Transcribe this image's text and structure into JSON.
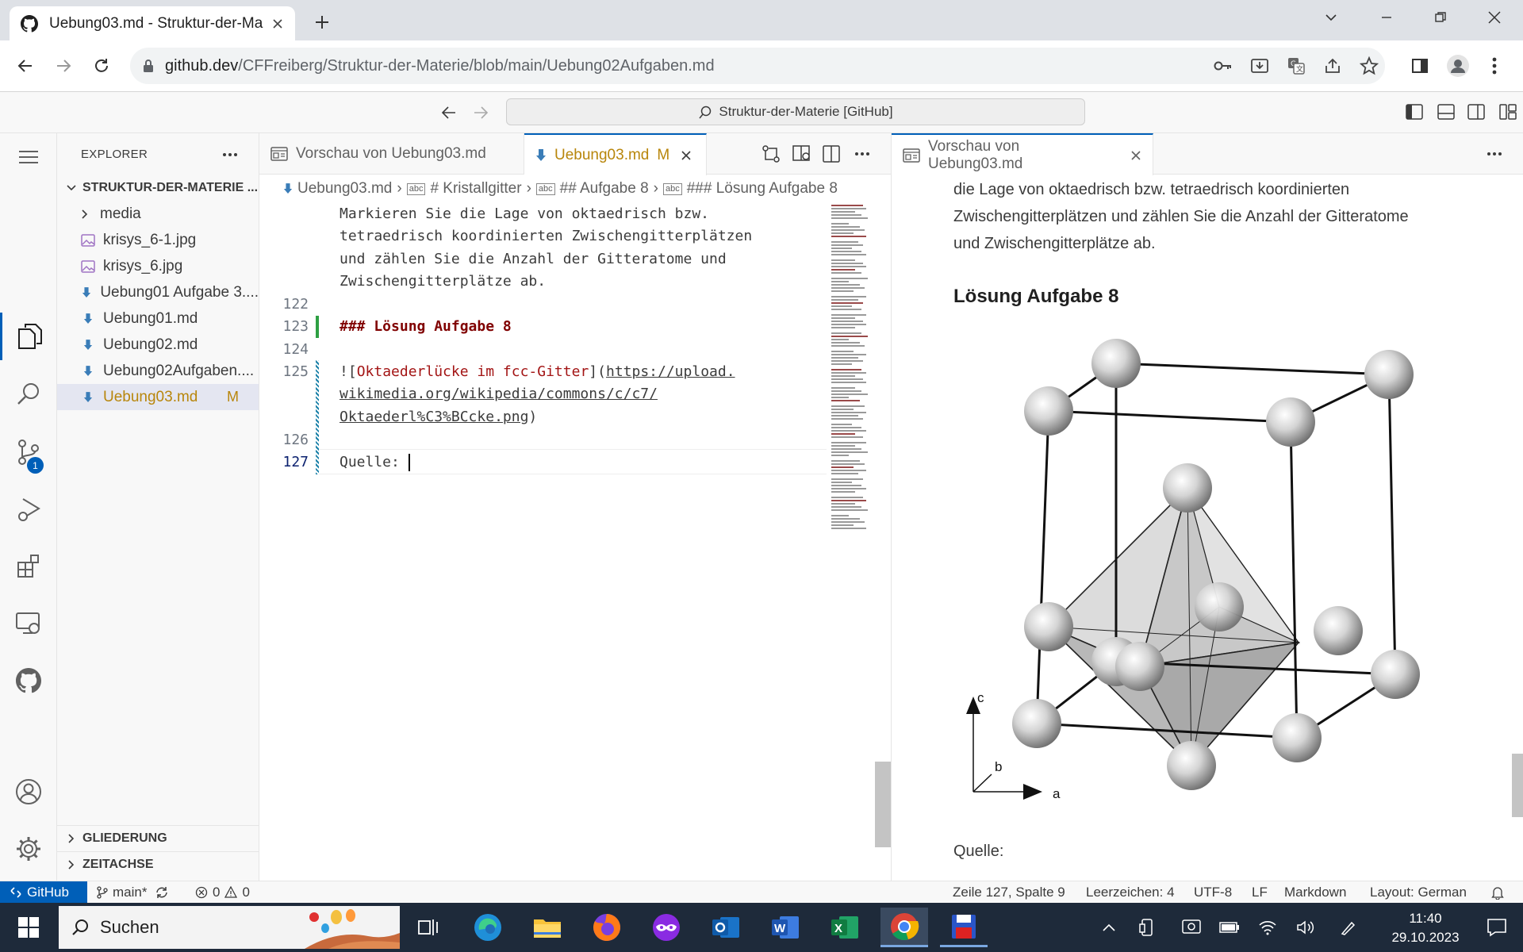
{
  "browser": {
    "tab_title": "Uebung03.md - Struktur-der-Ma",
    "url_host": "github.dev",
    "url_path": "/CFFreiberg/Struktur-der-Materie/blob/main/Uebung02Aufgaben.md"
  },
  "vscode": {
    "command_center": "Struktur-der-Materie [GitHub]"
  },
  "activity_bar": {
    "scm_badge": "1"
  },
  "sidebar": {
    "header": "EXPLORER",
    "root": "STRUKTUR-DER-MATERIE ...",
    "items": [
      {
        "label": "media",
        "kind": "folder"
      },
      {
        "label": "krisys_6-1.jpg",
        "kind": "image"
      },
      {
        "label": "krisys_6.jpg",
        "kind": "image"
      },
      {
        "label": "Uebung01 Aufgabe 3....",
        "kind": "markdown"
      },
      {
        "label": "Uebung01.md",
        "kind": "markdown"
      },
      {
        "label": "Uebung02.md",
        "kind": "markdown"
      },
      {
        "label": "Uebung02Aufgaben....",
        "kind": "markdown"
      },
      {
        "label": "Uebung03.md",
        "kind": "markdown",
        "status": "M"
      }
    ],
    "outline": "GLIEDERUNG",
    "timeline": "ZEITACHSE"
  },
  "editor1": {
    "tabs": [
      {
        "label": "Vorschau von Uebung03.md"
      },
      {
        "label": "Uebung03.md",
        "status": "M"
      }
    ],
    "breadcrumbs": [
      "Uebung03.md",
      "# Kristallgitter",
      "## Aufgabe 8",
      "### Lösung Aufgabe 8"
    ],
    "lines": [
      {
        "no": "",
        "text": "Markieren Sie die Lage von oktaedrisch bzw."
      },
      {
        "no": "",
        "text": "tetraedrisch koordinierten Zwischengitterplätzen"
      },
      {
        "no": "",
        "text": "und zählen Sie die Anzahl der Gitteratome und"
      },
      {
        "no": "",
        "text": "Zwischengitterplätze ab."
      },
      {
        "no": "122",
        "text": ""
      },
      {
        "no": "123",
        "text": "### Lösung Aufgabe 8"
      },
      {
        "no": "124",
        "text": ""
      },
      {
        "no": "125",
        "text_pre": "![",
        "link_text": "Oktaederlücke im fcc-Gitter",
        "text_mid": "](",
        "url1": "https://upload.",
        "url2": "wikimedia.org/wikipedia/commons/c/c7/",
        "url3": "Oktaederl%C3%BCcke.png",
        "text_post": ")"
      },
      {
        "no": "126",
        "text": ""
      },
      {
        "no": "127",
        "text": "Quelle: "
      }
    ]
  },
  "editor2": {
    "tab": "Vorschau von Uebung03.md",
    "para": [
      "die Lage von oktaedrisch bzw. tetraedrisch koordinierten",
      "Zwischengitterplätzen und zählen Sie die Anzahl der Gitteratome",
      "und Zwischengitterplätze ab."
    ],
    "heading": "Lösung Aufgabe 8",
    "figure_axes": {
      "c": "c",
      "b": "b",
      "a": "a"
    },
    "source": "Quelle:"
  },
  "statusbar": {
    "remote": "GitHub",
    "branch": "main*",
    "errors": "0",
    "warnings": "0",
    "position": "Zeile 127, Spalte 9",
    "indent": "Leerzeichen: 4",
    "encoding": "UTF-8",
    "eol": "LF",
    "language": "Markdown",
    "layout": "Layout: German"
  },
  "taskbar": {
    "search": "Suchen",
    "time": "11:40",
    "date": "29.10.2023"
  }
}
